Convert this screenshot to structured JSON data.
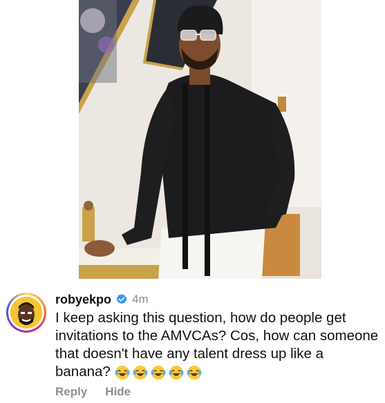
{
  "comment": {
    "username": "robyekpo",
    "time": "4m",
    "text": "I keep asking this question, how do people get invitations to the AMVCAs? Cos, how can someone that doesn't have any talent dress up like  a banana?",
    "emojis": [
      "laughing-crying-emoji",
      "laughing-crying-emoji",
      "laughing-crying-emoji",
      "laughing-crying-emoji",
      "laughing-crying-emoji"
    ],
    "reply_label": "Reply",
    "hide_label": "Hide"
  },
  "colors": {
    "verified_blue": "#3897f0",
    "muted_text": "#8e8e8e",
    "avatar_bg": "#f7c531"
  }
}
